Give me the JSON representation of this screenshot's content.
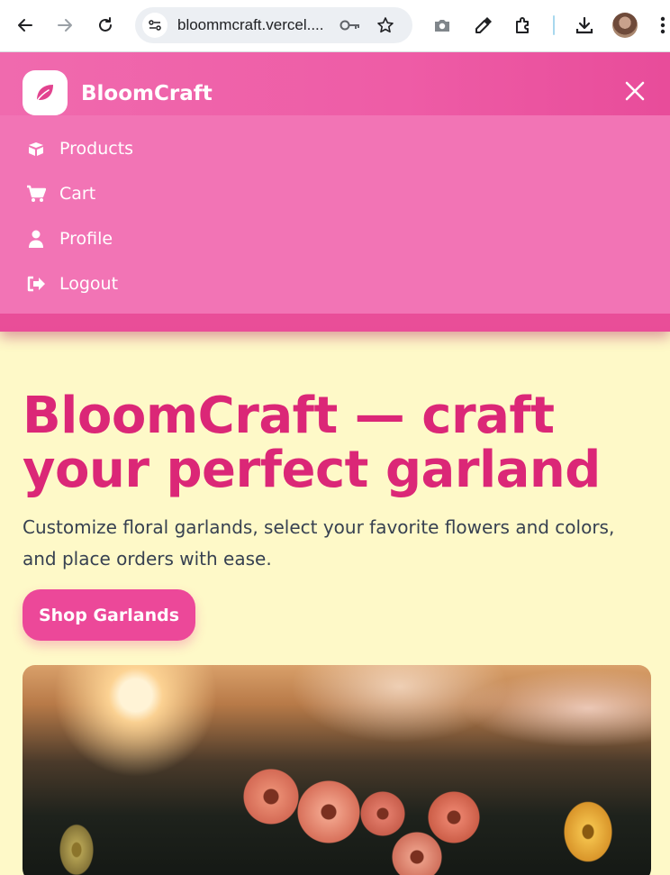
{
  "browser": {
    "url": "bloommcraft.vercel...."
  },
  "nav": {
    "brand": "BloomCraft",
    "menu": [
      {
        "label": "Products",
        "icon": "box-icon"
      },
      {
        "label": "Cart",
        "icon": "cart-icon"
      },
      {
        "label": "Profile",
        "icon": "user-icon"
      },
      {
        "label": "Logout",
        "icon": "logout-icon"
      }
    ]
  },
  "hero": {
    "title": "BloomCraft — craft your perfect garland",
    "subtitle": "Customize floral garlands, select your favorite flowers and colors, and place orders with ease.",
    "cta": "Shop Garlands"
  },
  "colors": {
    "brand_pink": "#ec4899",
    "title_pink": "#db2777",
    "page_bg": "#fef9c8",
    "menu_bg": "#f274b5"
  }
}
